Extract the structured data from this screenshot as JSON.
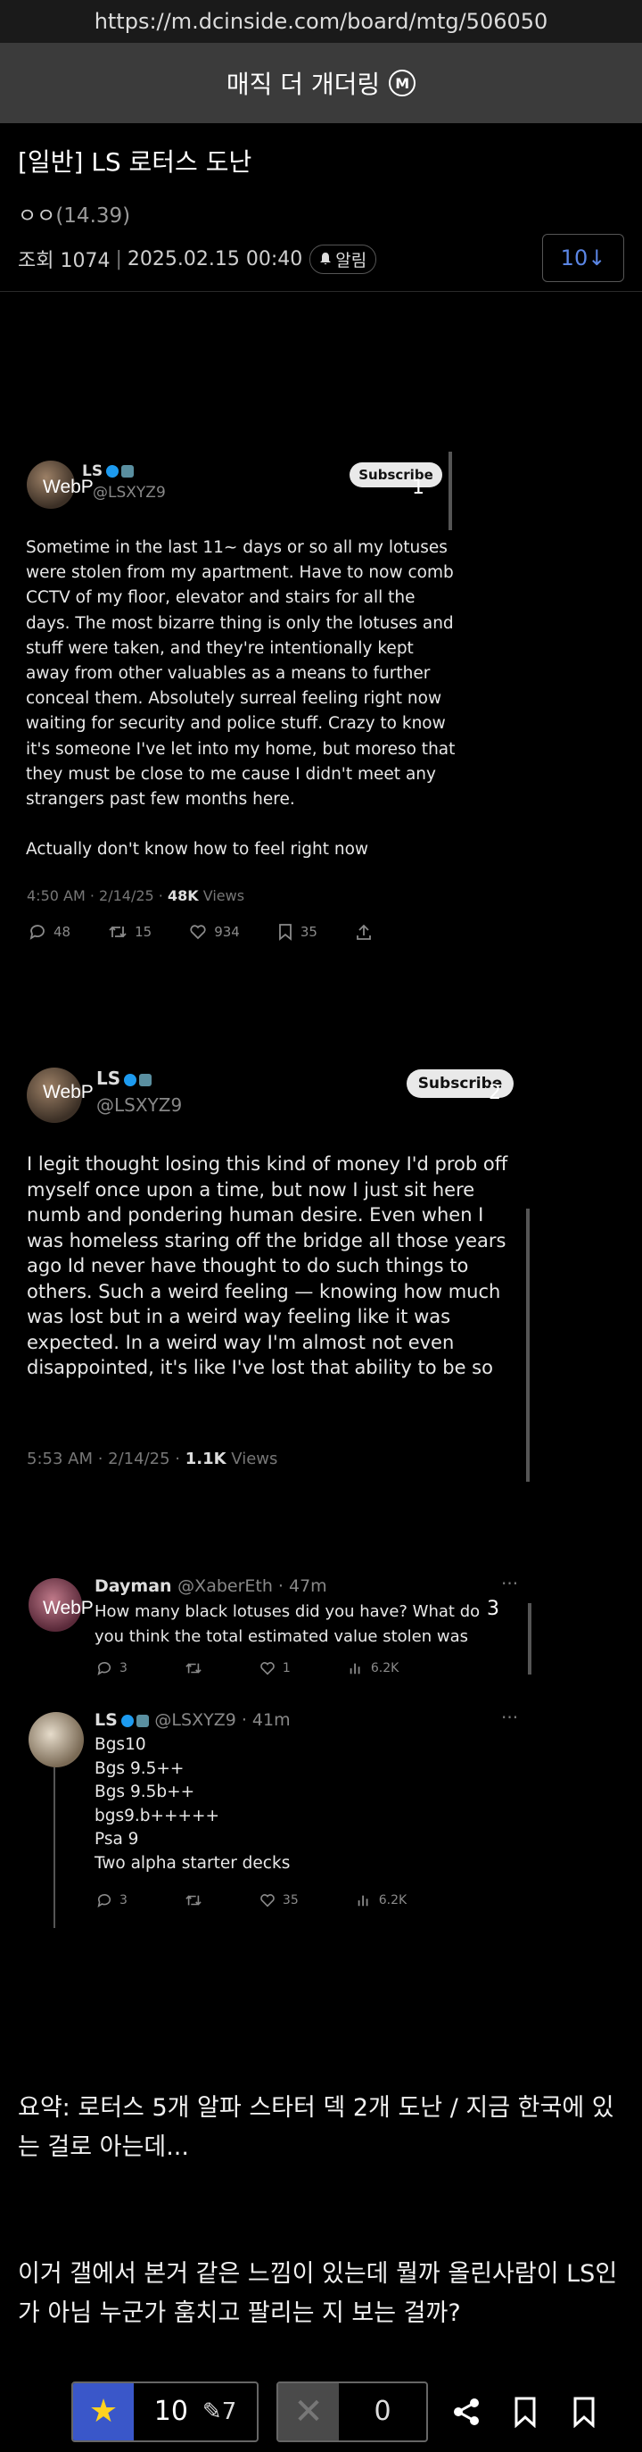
{
  "browser": {
    "url": "https://m.dcinside.com/board/mtg/506050"
  },
  "gallery": {
    "name": "매직 더 개더링",
    "badge": "M"
  },
  "post": {
    "title": "[일반] LS 로터스 도난",
    "author": "ㅇㅇ",
    "author_ip": "(14.39)",
    "views": "조회 1074",
    "date": "2025.02.15 00:40",
    "alarm": "알림",
    "comment_jump": "10↓"
  },
  "image_overlay_label": "WebP",
  "tweets": [
    {
      "index": "1",
      "name": "LS",
      "handle": "@LSXYZ9",
      "subscribe": "Subscribe",
      "text": "Sometime in the last 11~ days or so all my lotuses\nwere stolen from my apartment. Have to now comb\nCCTV of my floor, elevator and stairs for all the\ndays. The most bizarre thing is only the lotuses and\nstuff were taken, and they're intentionally kept\naway from other valuables as a means to further\nconceal them. Absolutely surreal feeling right now\nwaiting for security and police stuff. Crazy to know\nit's someone I've let into my home, but moreso that\nthey must be close to me cause I didn't meet any\nstrangers past few months here.\n\nActually don't know how to feel right now",
      "time": "4:50 AM · 2/14/25 · ",
      "views_count": "48K",
      "views_label": " Views",
      "replies": "48",
      "retweets": "15",
      "likes": "934",
      "bookmarks": "35"
    },
    {
      "index": "2",
      "name": "LS",
      "handle": "@LSXYZ9",
      "subscribe": "Subscribe",
      "text": "I legit thought losing this kind of money I'd prob off\nmyself once upon a time, but now I just sit here\nnumb and pondering human desire. Even when I\nwas homeless staring off the bridge all those years\nago Id never have thought to do such things to\nothers. Such a weird feeling — knowing how much\nwas lost but in a weird way feeling like it was\nexpected. In a weird way I'm almost not even\ndisappointed, it's like I've lost that ability to be so",
      "time": "5:53 AM · 2/14/25 · ",
      "views_count": "1.1K",
      "views_label": " Views"
    },
    {
      "index": "3",
      "reply": {
        "name": "Dayman",
        "handle": "@XaberEth · 47m",
        "text": "How many black lotuses did you have? What do\nyou think the total estimated value stolen was",
        "replies": "3",
        "likes": "1",
        "views": "6.2K"
      },
      "answer": {
        "name": "LS",
        "handle": "@LSXYZ9 · 41m",
        "text": "Bgs10\nBgs 9.5++\nBgs 9.5b++\nbgs9.b+++++\nPsa 9\nTwo alpha starter decks",
        "replies": "3",
        "likes": "35",
        "views": "6.2K"
      }
    }
  ],
  "summary": "요약: 로터스 5개 알파 스타터 덱 2개 도난 / 지금 한국에 있는 걸로 아는데...",
  "comment_text": "이거 갤에서 본거 같은 느낌이 있는데 뭘까 올린사람이 LS인가 아님 누군가 훔치고 팔리는 지 보는 걸까?",
  "bottom_bar": {
    "recommend_count": "10",
    "fixed_recommend_count": "7",
    "not_recommend_count": "0"
  }
}
